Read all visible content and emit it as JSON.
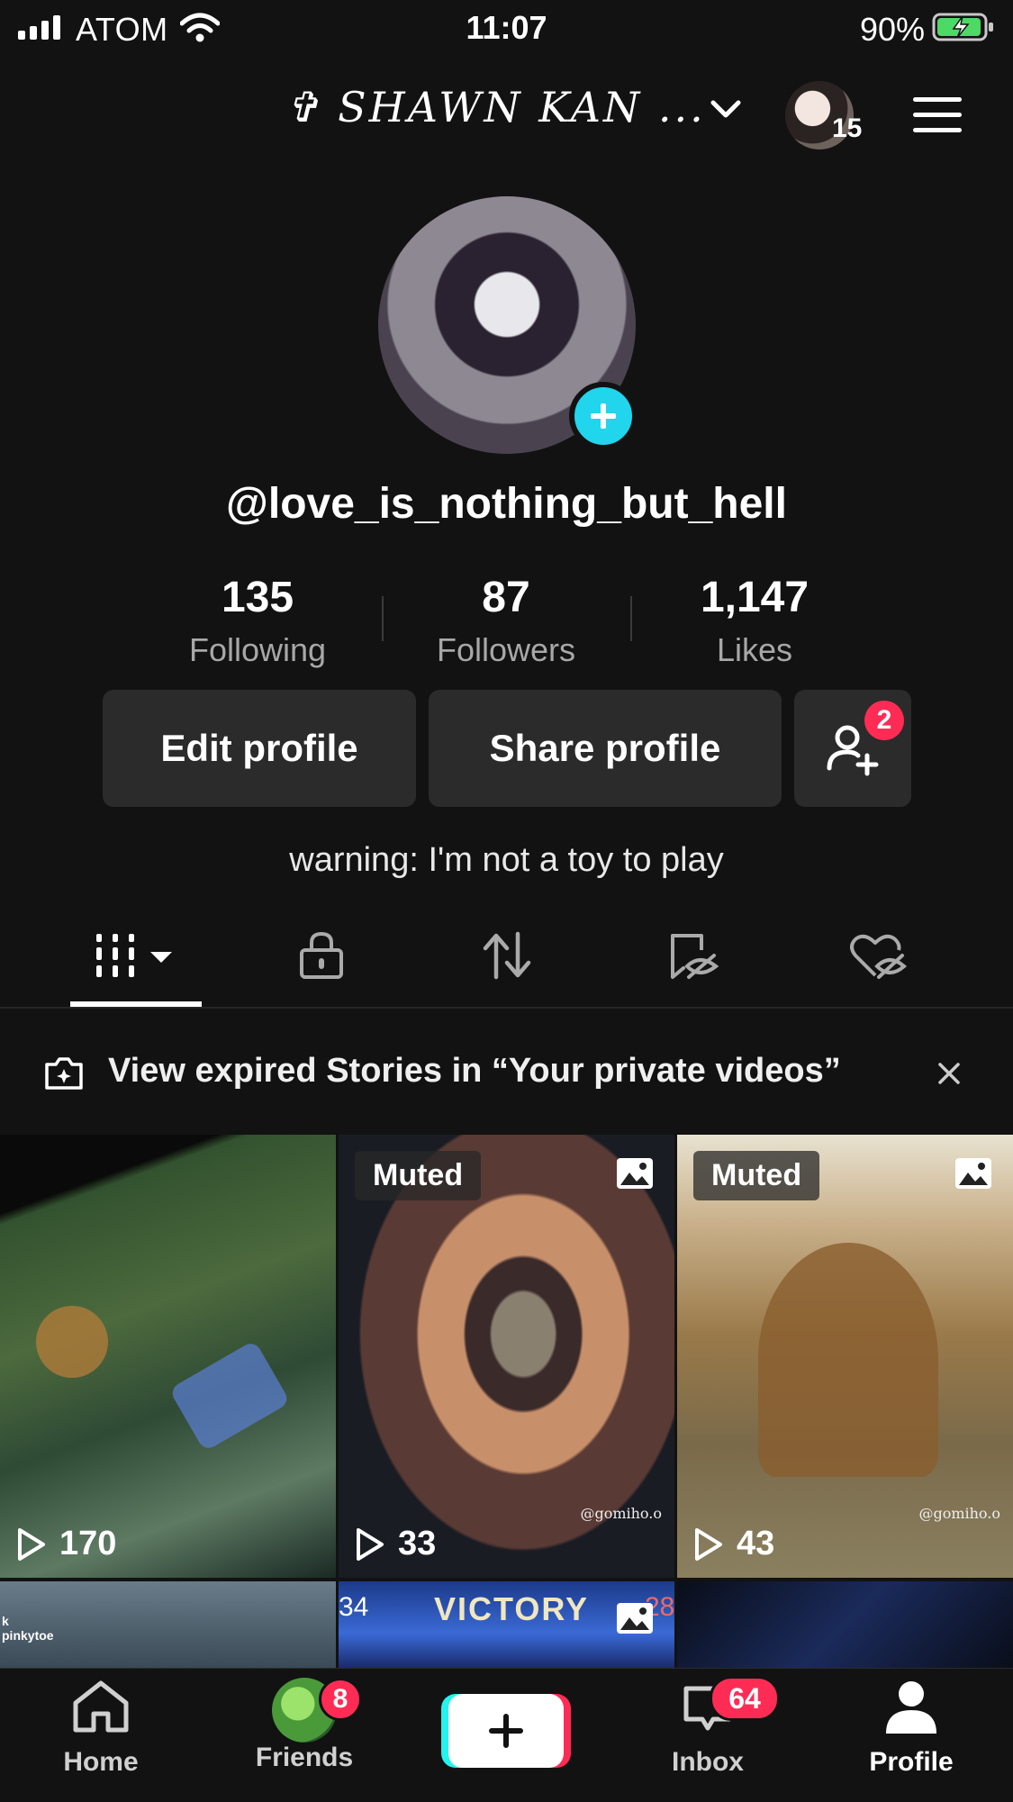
{
  "status_bar": {
    "carrier": "ATOM",
    "time": "11:07",
    "battery": "90%"
  },
  "header": {
    "account_name": "✞ SHAWN KAN ...",
    "mini_avatar_count": "15"
  },
  "profile": {
    "username": "@love_is_nothing_but_hell",
    "stats": [
      {
        "value": "135",
        "label": "Following"
      },
      {
        "value": "87",
        "label": "Followers"
      },
      {
        "value": "1,147",
        "label": "Likes"
      }
    ],
    "edit_label": "Edit profile",
    "share_label": "Share profile",
    "friends_badge": "2",
    "bio": "warning: I'm not a toy to play"
  },
  "banner": {
    "text": "View expired Stories in “Your private videos”"
  },
  "grid": [
    {
      "views": "170",
      "muted": ""
    },
    {
      "views": "33",
      "muted": "Muted",
      "watermark": "@gomiho.o"
    },
    {
      "views": "43",
      "muted": "Muted",
      "watermark": "@gomiho.o"
    }
  ],
  "grid_row2": {
    "tile1_text": "k\npinkytoe",
    "tile2_text": "VICTORY",
    "tile2_left": "34",
    "tile2_right": "28"
  },
  "nav": {
    "home": "Home",
    "friends": "Friends",
    "friends_badge": "8",
    "inbox": "Inbox",
    "inbox_badge": "64",
    "profile": "Profile"
  },
  "colors": {
    "accent_cyan": "#20d5ec",
    "badge_red": "#fe2c55",
    "background": "#121212"
  }
}
